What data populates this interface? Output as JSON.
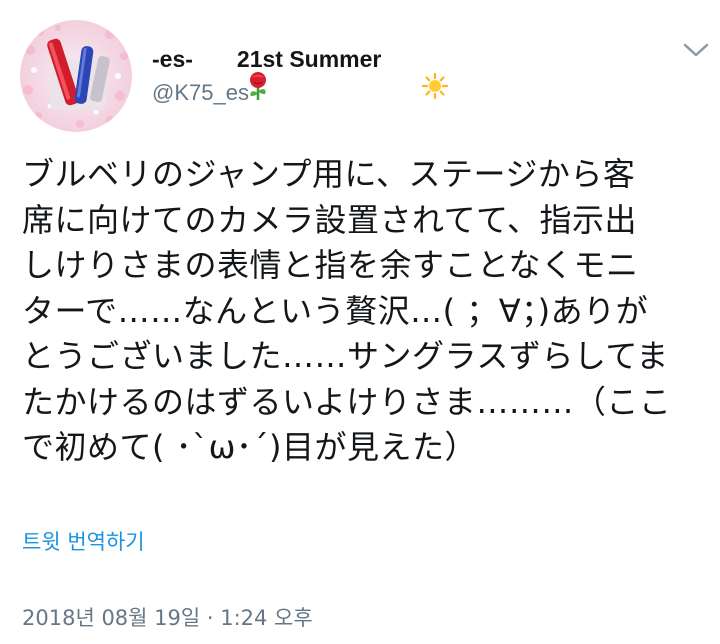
{
  "tweet": {
    "author": {
      "name_prefix": "-es-",
      "name_suffix": "21st Summer",
      "name_icons": [
        "rose-icon",
        "sun-icon"
      ],
      "handle": "@K75_es",
      "avatar_icon": "avatar-penlights-photo"
    },
    "menu_icon": "chevron-down-icon",
    "text_lines": [
      "ブルベリのジャンプ用に、ステージから客",
      "席に向けてのカメラ設置されてて、指示出",
      "しけりさまの表情と指を余すことなくモニ",
      "ターで……なんという贅沢…( ；∀；)ありが",
      "とうございました……サングラスずらしてま",
      "たかけるのはずるいよけりさま………（ここ",
      "で初めて( ･`ω･´)目が見えた）"
    ],
    "translate_label": "트윗 번역하기",
    "timestamp": "2018년 08월 19일 · 1:24 오후"
  },
  "colors": {
    "text": "#14171a",
    "secondary": "#657786",
    "link": "#1b95e0",
    "background": "#ffffff"
  }
}
